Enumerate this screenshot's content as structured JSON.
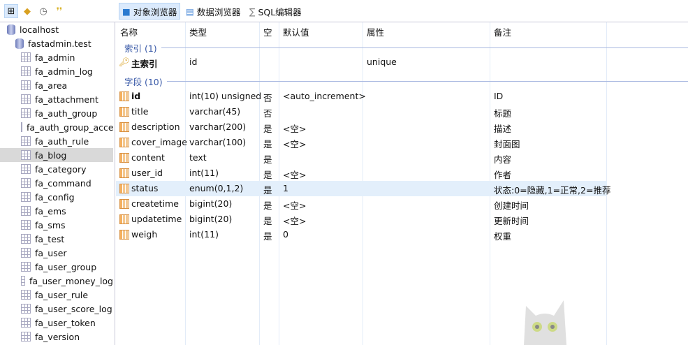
{
  "toolbar": {
    "icons": [
      "tree-view-icon",
      "objects-icon",
      "history-icon",
      "footsteps-icon"
    ],
    "tabs": [
      {
        "label": "对象浏览器",
        "icon": "object-browser-icon",
        "active": true
      },
      {
        "label": "数据浏览器",
        "icon": "data-browser-icon"
      },
      {
        "label": "SQL编辑器",
        "icon": "sql-editor-icon"
      }
    ]
  },
  "sidebar": {
    "server": "localhost",
    "database": "fastadmin.test",
    "selected": "fa_blog",
    "tables": [
      "fa_admin",
      "fa_admin_log",
      "fa_area",
      "fa_attachment",
      "fa_auth_group",
      "fa_auth_group_acce",
      "fa_auth_rule",
      "fa_blog",
      "fa_category",
      "fa_command",
      "fa_config",
      "fa_ems",
      "fa_sms",
      "fa_test",
      "fa_user",
      "fa_user_group",
      "fa_user_money_log",
      "fa_user_rule",
      "fa_user_score_log",
      "fa_user_token",
      "fa_version"
    ]
  },
  "columns": [
    "名称",
    "类型",
    "空",
    "默认值",
    "属性",
    "备注"
  ],
  "index_group": "索引 (1)",
  "index": {
    "name": "主索引",
    "type": "id",
    "attr": "unique"
  },
  "field_group": "字段 (10)",
  "fields": [
    {
      "name": "id",
      "type": "int(10) unsigned",
      "null": "否",
      "default": "<auto_increment>",
      "comment": "ID"
    },
    {
      "name": "title",
      "type": "varchar(45)",
      "null": "否",
      "default": "",
      "comment": "标题"
    },
    {
      "name": "description",
      "type": "varchar(200)",
      "null": "是",
      "default": "<空>",
      "comment": "描述"
    },
    {
      "name": "cover_image",
      "type": "varchar(100)",
      "null": "是",
      "default": "<空>",
      "comment": "封面图"
    },
    {
      "name": "content",
      "type": "text",
      "null": "是",
      "default": "",
      "comment": "内容"
    },
    {
      "name": "user_id",
      "type": "int(11)",
      "null": "是",
      "default": "<空>",
      "comment": "作者"
    },
    {
      "name": "status",
      "type": "enum(0,1,2)",
      "null": "是",
      "default": "1",
      "comment": "状态:0=隐藏,1=正常,2=推荐"
    },
    {
      "name": "createtime",
      "type": "bigint(20)",
      "null": "是",
      "default": "<空>",
      "comment": "创建时间"
    },
    {
      "name": "updatetime",
      "type": "bigint(20)",
      "null": "是",
      "default": "<空>",
      "comment": "更新时间"
    },
    {
      "name": "weigh",
      "type": "int(11)",
      "null": "是",
      "default": "0",
      "comment": "权重"
    }
  ],
  "selected_field": "status"
}
